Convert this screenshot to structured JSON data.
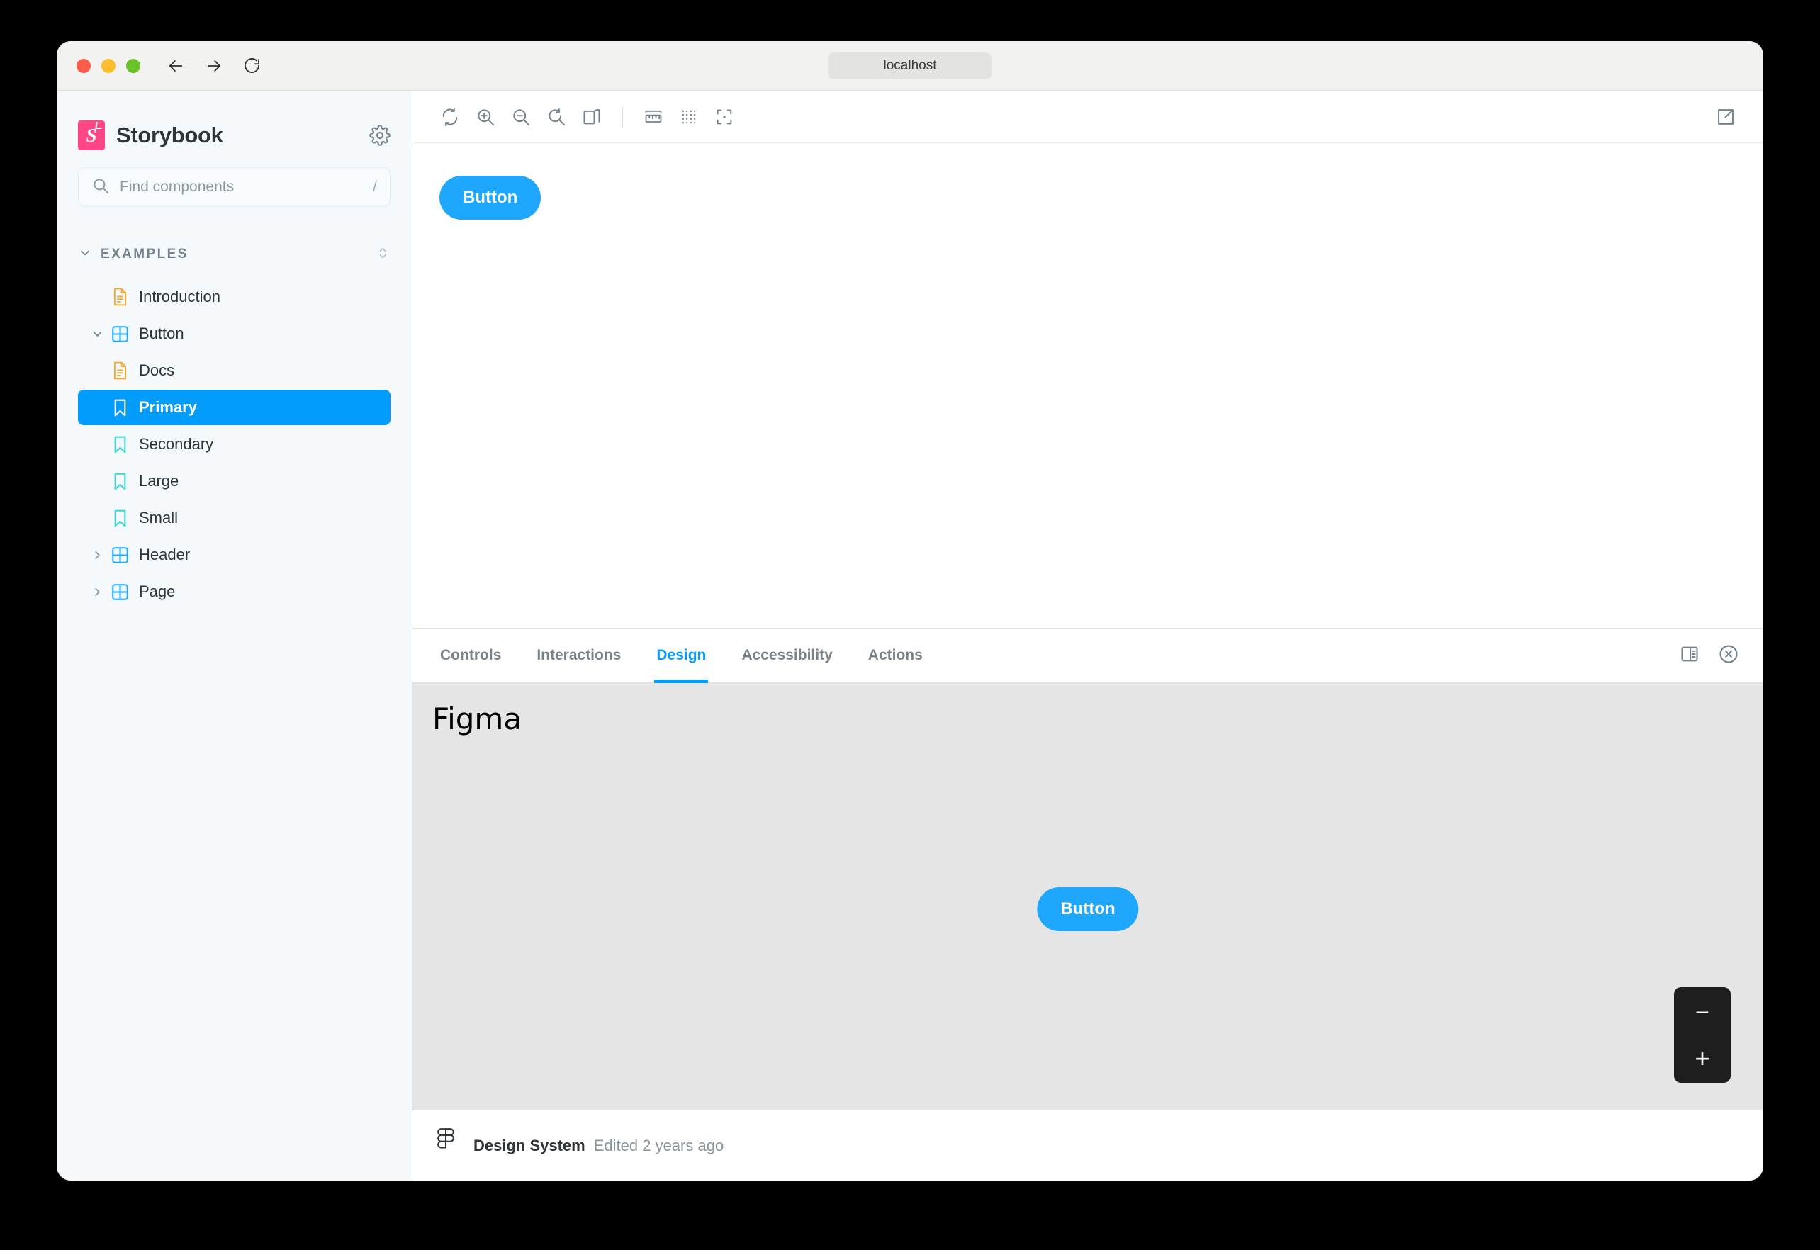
{
  "browser": {
    "url": "localhost",
    "back_icon": "arrow-left-icon",
    "forward_icon": "arrow-right-icon",
    "reload_icon": "reload-icon",
    "traffic_lights": [
      "close",
      "minimize",
      "maximize"
    ]
  },
  "sidebar": {
    "brand": "Storybook",
    "settings_icon": "gear-icon",
    "search": {
      "placeholder": "Find components",
      "value": "",
      "shortcut": "/",
      "icon": "search-icon"
    },
    "group": {
      "label": "EXAMPLES",
      "expanded": true,
      "sort_icon": "expand-collapse-icon"
    },
    "items": [
      {
        "label": "Introduction",
        "icon": "document-icon",
        "depth": 1,
        "expandable": false,
        "selected": false
      },
      {
        "label": "Button",
        "icon": "component-icon",
        "depth": 1,
        "expandable": true,
        "expanded": true,
        "selected": false
      },
      {
        "label": "Docs",
        "icon": "document-icon",
        "depth": 2,
        "expandable": false,
        "selected": false
      },
      {
        "label": "Primary",
        "icon": "story-icon",
        "depth": 2,
        "expandable": false,
        "selected": true
      },
      {
        "label": "Secondary",
        "icon": "story-icon",
        "depth": 2,
        "expandable": false,
        "selected": false
      },
      {
        "label": "Large",
        "icon": "story-icon",
        "depth": 2,
        "expandable": false,
        "selected": false
      },
      {
        "label": "Small",
        "icon": "story-icon",
        "depth": 2,
        "expandable": false,
        "selected": false
      },
      {
        "label": "Header",
        "icon": "component-icon",
        "depth": 1,
        "expandable": true,
        "expanded": false,
        "selected": false
      },
      {
        "label": "Page",
        "icon": "component-icon",
        "depth": 1,
        "expandable": true,
        "expanded": false,
        "selected": false
      }
    ]
  },
  "toolbar": {
    "buttons": [
      {
        "name": "remount-icon",
        "title": "Remount component"
      },
      {
        "name": "zoom-in-icon",
        "title": "Zoom in"
      },
      {
        "name": "zoom-out-icon",
        "title": "Zoom out"
      },
      {
        "name": "zoom-reset-icon",
        "title": "Reset zoom"
      },
      {
        "name": "background-icon",
        "title": "Change background"
      },
      {
        "name": "measure-icon",
        "title": "Enable measure"
      },
      {
        "name": "grid-icon",
        "title": "Apply grid"
      },
      {
        "name": "outline-icon",
        "title": "Apply outlines"
      }
    ],
    "open_new_tab_icon": "external-link-icon"
  },
  "preview": {
    "button_label": "Button"
  },
  "panel": {
    "tabs": [
      {
        "label": "Controls",
        "active": false
      },
      {
        "label": "Interactions",
        "active": false
      },
      {
        "label": "Design",
        "active": true
      },
      {
        "label": "Accessibility",
        "active": false
      },
      {
        "label": "Actions",
        "active": false
      }
    ],
    "layout_icon": "panel-position-icon",
    "close_icon": "close-circle-icon"
  },
  "figma": {
    "title": "Figma",
    "canvas_button_label": "Button",
    "zoom_out_label": "–",
    "zoom_in_label": "+",
    "footer": {
      "logo_icon": "figma-logo-icon",
      "file_name": "Design System",
      "edited": "Edited 2 years ago"
    }
  },
  "colors": {
    "accent": "#029cfd",
    "button_blue": "#1ea7fd",
    "storybook_pink": "#ff4785",
    "story_teal": "#37d5d3",
    "docs_orange": "#f9a826",
    "component_blue": "#1ea7fd",
    "sidebar_bg": "#f6f9fc",
    "figma_bg": "#e5e5e5"
  }
}
